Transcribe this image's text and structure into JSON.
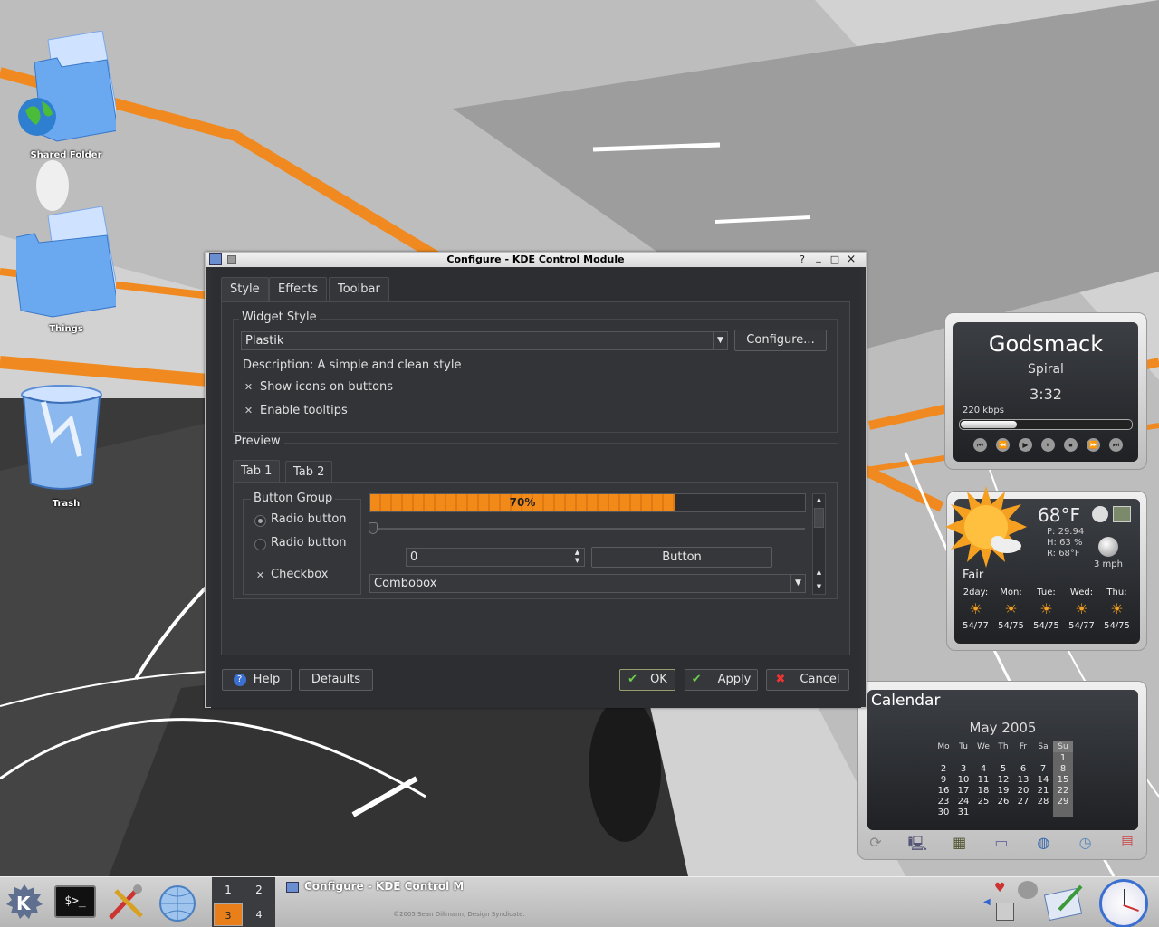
{
  "desktop": {
    "icons": [
      {
        "label": "Shared Folder"
      },
      {
        "label": "Things"
      },
      {
        "label": "Trash"
      }
    ]
  },
  "dialog": {
    "title": "Configure - KDE Control Module",
    "titlebar_buttons": {
      "help": "?",
      "minimize": "_",
      "maximize": "□",
      "close": "×"
    },
    "tabs": [
      {
        "label": "Style",
        "active": true
      },
      {
        "label": "Effects",
        "active": false
      },
      {
        "label": "Toolbar",
        "active": false
      }
    ],
    "widget_style": {
      "group_title": "Widget Style",
      "selected": "Plastik",
      "configure_label": "Configure...",
      "description": "Description: A simple and clean style",
      "show_icons": {
        "label": "Show icons on buttons",
        "checked": true
      },
      "enable_tooltips": {
        "label": "Enable tooltips",
        "checked": true
      }
    },
    "preview": {
      "title": "Preview",
      "tabs": [
        {
          "label": "Tab 1",
          "active": true
        },
        {
          "label": "Tab 2",
          "active": false
        }
      ],
      "button_group": {
        "title": "Button Group",
        "radio1": {
          "label": "Radio button",
          "checked": true
        },
        "radio2": {
          "label": "Radio button",
          "checked": false
        },
        "checkbox": {
          "label": "Checkbox",
          "checked": true
        }
      },
      "progress": {
        "value": 0.7,
        "label": "70%"
      },
      "spinbox_value": "0",
      "button_label": "Button",
      "combobox_value": "Combobox"
    },
    "buttons": {
      "help": "Help",
      "defaults": "Defaults",
      "ok": "OK",
      "apply": "Apply",
      "cancel": "Cancel"
    }
  },
  "media_player": {
    "artist": "Godsmack",
    "track": "Spiral",
    "time": "3:32",
    "bitrate": "220 kbps",
    "progress": 0.33
  },
  "weather": {
    "temp": "68°F",
    "pressure": "P: 29.94",
    "humidity": "H: 63 %",
    "realfeel": "R: 68°F",
    "wind": "3 mph",
    "condition": "Fair",
    "forecast": [
      {
        "day": "2day:",
        "temps": "54/77"
      },
      {
        "day": "Mon:",
        "temps": "54/75"
      },
      {
        "day": "Tue:",
        "temps": "54/75"
      },
      {
        "day": "Wed:",
        "temps": "54/77"
      },
      {
        "day": "Thu:",
        "temps": "54/75"
      }
    ]
  },
  "calendar": {
    "title": "Calendar",
    "month": "May 2005",
    "weekdays": [
      "Mo",
      "Tu",
      "We",
      "Th",
      "Fr",
      "Sa",
      "Su"
    ],
    "weeks": [
      [
        "",
        "",
        "",
        "",
        "",
        "",
        "1"
      ],
      [
        "2",
        "3",
        "4",
        "5",
        "6",
        "7",
        "8"
      ],
      [
        "9",
        "10",
        "11",
        "12",
        "13",
        "14",
        "15"
      ],
      [
        "16",
        "17",
        "18",
        "19",
        "20",
        "21",
        "22"
      ],
      [
        "23",
        "24",
        "25",
        "26",
        "27",
        "28",
        "29"
      ],
      [
        "30",
        "31",
        "",
        "",
        "",
        "",
        ""
      ]
    ]
  },
  "taskbar": {
    "desktops": [
      "1",
      "2",
      "3",
      "4"
    ],
    "task_title": "Configure - KDE Control Mo",
    "credit": "©2005 Sean Dillmann, Design Syndicate."
  },
  "colors": {
    "accent_orange": "#f28a1a",
    "dialog_bg": "#2f3134"
  }
}
